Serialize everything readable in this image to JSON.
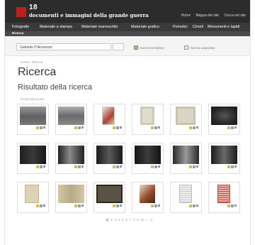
{
  "header": {
    "logo_number": "18",
    "logo_text": "documenti e immagini della grande guerra",
    "links": [
      "Home",
      "Mappa del sito",
      "Cerca nel sito"
    ]
  },
  "nav": {
    "items": [
      "Fotografie",
      "Materiale a stampa",
      "Materiale manoscritto",
      "Materiale grafico",
      "Periodici",
      "Cimeli",
      "Monumenti e lapidi"
    ],
    "subnav_label": "Ricerca"
  },
  "search": {
    "value": "Gabriele D'Annunzio",
    "button_label": "→",
    "option_simple": "ricerca semplice",
    "option_advanced": "ricerca avanzata"
  },
  "breadcrumb": "Home › Ricerca",
  "page_title": "Ricerca",
  "results_title": "Risultato della ricerca",
  "results_count": "Trovati 396 record",
  "pagination": {
    "pages": [
      "1",
      "2",
      "3",
      "4",
      "5",
      "6",
      "7",
      "8",
      "9",
      "10"
    ],
    "next": "»",
    "last": "»|"
  },
  "colors": {
    "accent": "#c01e1e",
    "header_bg": "#2c2c2c",
    "nav_bg": "#3a3a3a"
  }
}
